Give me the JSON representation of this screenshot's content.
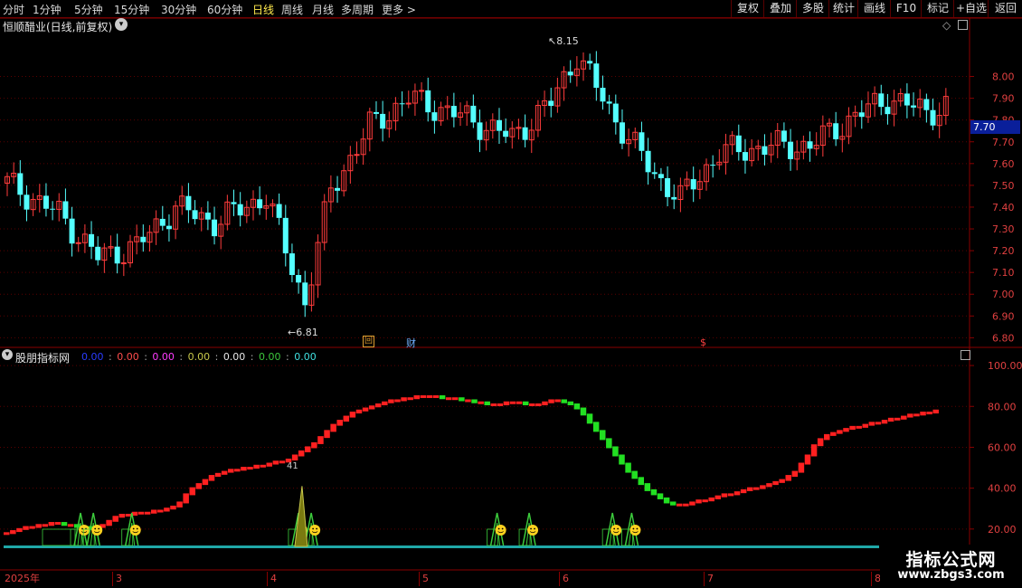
{
  "toolbar": {
    "periods": [
      "分时",
      "1分钟",
      "5分钟",
      "15分钟",
      "30分钟",
      "60分钟",
      "日线",
      "周线",
      "月线",
      "多周期",
      "更多 >"
    ],
    "active_period": "日线",
    "right_buttons": [
      "复权",
      "叠加",
      "多股",
      "统计",
      "画线",
      "F10",
      "标记",
      "+自选",
      "返回"
    ]
  },
  "main_panel": {
    "title": "恒顺醋业(日线,前复权)",
    "high_label": "8.15",
    "low_label": "6.81",
    "current_price": "7.70",
    "markers": {
      "hui": "回",
      "cai": "财",
      "dollar": "$"
    }
  },
  "indicator_panel": {
    "title": "股朋指标网",
    "values": [
      "0.00",
      "0.00",
      "0.00",
      "0.00",
      "0.00",
      "0.00",
      "0.00"
    ],
    "value_colors": [
      "#2a3cff",
      "#ff4d4d",
      "#ff3cff",
      "#c8c84a",
      "#e6e6e6",
      "#3cc83c",
      "#40e0e0"
    ],
    "peak_label": "41"
  },
  "x_axis": [
    "2025年",
    "3",
    "4",
    "5",
    "6",
    "7",
    "8"
  ],
  "watermark": {
    "line1": "指标公式网",
    "line2": "www.zbgs3.com"
  },
  "chart_data": {
    "type": "candlestick",
    "title": "恒顺醋业(日线,前复权)",
    "price_axis_ticks": [
      6.8,
      6.9,
      7.0,
      7.1,
      7.2,
      7.3,
      7.4,
      7.5,
      7.6,
      7.7,
      7.8,
      7.9,
      8.0
    ],
    "price_range": [
      6.76,
      8.21
    ],
    "price_high": 8.15,
    "price_low": 6.81,
    "last_price": 7.7,
    "indicator_axis_ticks": [
      20,
      40,
      60,
      80,
      100
    ],
    "indicator_range": [
      0,
      108
    ],
    "month_ticks": [
      "2025年",
      "3",
      "4",
      "5",
      "6",
      "7",
      "8"
    ],
    "line": [
      18,
      19,
      20,
      21,
      21,
      22,
      22,
      23,
      23,
      22,
      22,
      21,
      21,
      20,
      21,
      22,
      24,
      26,
      27,
      27,
      28,
      28,
      28,
      29,
      29,
      30,
      31,
      33,
      37,
      40,
      42,
      44,
      46,
      47,
      48,
      49,
      49,
      50,
      50,
      51,
      51,
      52,
      53,
      53,
      54,
      56,
      58,
      60,
      62,
      65,
      68,
      71,
      73,
      75,
      77,
      78,
      79,
      80,
      81,
      82,
      83,
      83,
      84,
      84,
      85,
      85,
      85,
      85,
      84,
      84,
      84,
      83,
      83,
      82,
      82,
      81,
      81,
      81,
      82,
      82,
      82,
      81,
      81,
      81,
      82,
      83,
      83,
      82,
      81,
      79,
      76,
      72,
      68,
      64,
      60,
      56,
      52,
      48,
      45,
      42,
      39,
      37,
      35,
      33,
      32,
      32,
      32,
      33,
      34,
      34,
      35,
      36,
      37,
      37,
      38,
      39,
      40,
      40,
      41,
      42,
      43,
      44,
      46,
      48,
      52,
      56,
      61,
      64,
      66,
      67,
      68,
      69,
      70,
      70,
      71,
      72,
      72,
      73,
      74,
      74,
      75,
      76,
      76,
      77,
      77,
      78
    ],
    "signal_indices": [
      12,
      14,
      20,
      46,
      48,
      77,
      82,
      95,
      98
    ],
    "big_peak_value": 41,
    "big_peak_index": 46
  },
  "colors": {
    "up": "#ff3c3c",
    "down": "#54ffff",
    "line_up": "#ff2020",
    "line_down": "#22e022",
    "axis": "#8a0000",
    "base": "#1fa8a8"
  }
}
